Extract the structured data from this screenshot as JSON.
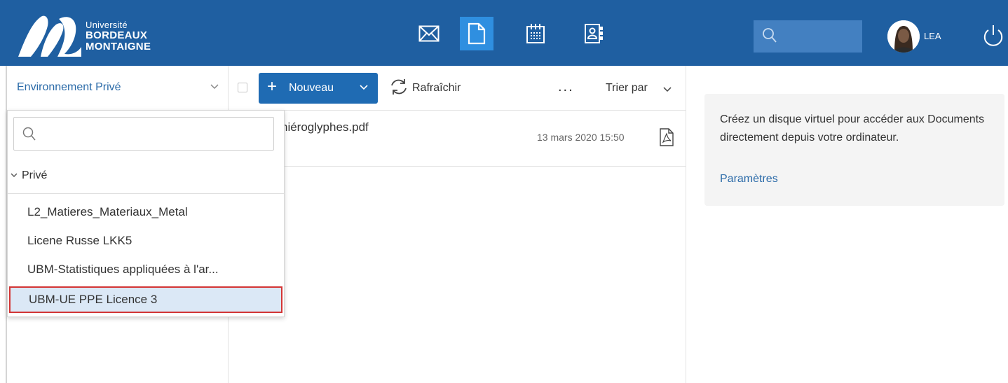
{
  "header": {
    "logo": {
      "line1": "Université",
      "line2": "BORDEAUX",
      "line3": "MONTAIGNE"
    },
    "apps": [
      {
        "name": "mail-icon",
        "active": false
      },
      {
        "name": "documents-icon",
        "active": true
      },
      {
        "name": "calendar-icon",
        "active": false
      },
      {
        "name": "contacts-icon",
        "active": false
      }
    ],
    "search_placeholder": "",
    "user": {
      "name": "LEA"
    },
    "colors": {
      "bar": "#1f5fa1",
      "active_app": "#2f8fe0"
    }
  },
  "sidebar": {
    "environment": "Environnement Privé",
    "dropdown": {
      "search_placeholder": "",
      "group": "Privé",
      "items": [
        "L2_Matieres_Materiaux_Metal",
        "Licene Russe LKK5",
        "UBM-Statistiques appliquées à l'ar...",
        "UBM-UE PPE Licence 3"
      ],
      "selected_index": 3
    }
  },
  "toolbar": {
    "new_label": "Nouveau",
    "refresh_label": "Rafraîchir",
    "more_label": "...",
    "sort_label": "Trier par"
  },
  "files": [
    {
      "name": "hiéroglyphes.pdf",
      "date": "13 mars 2020 15:50",
      "icon": "pdf-icon"
    }
  ],
  "info_panel": {
    "text": "Créez un disque virtuel pour accéder aux Documents directement depuis votre ordinateur.",
    "link": "Paramètres"
  }
}
